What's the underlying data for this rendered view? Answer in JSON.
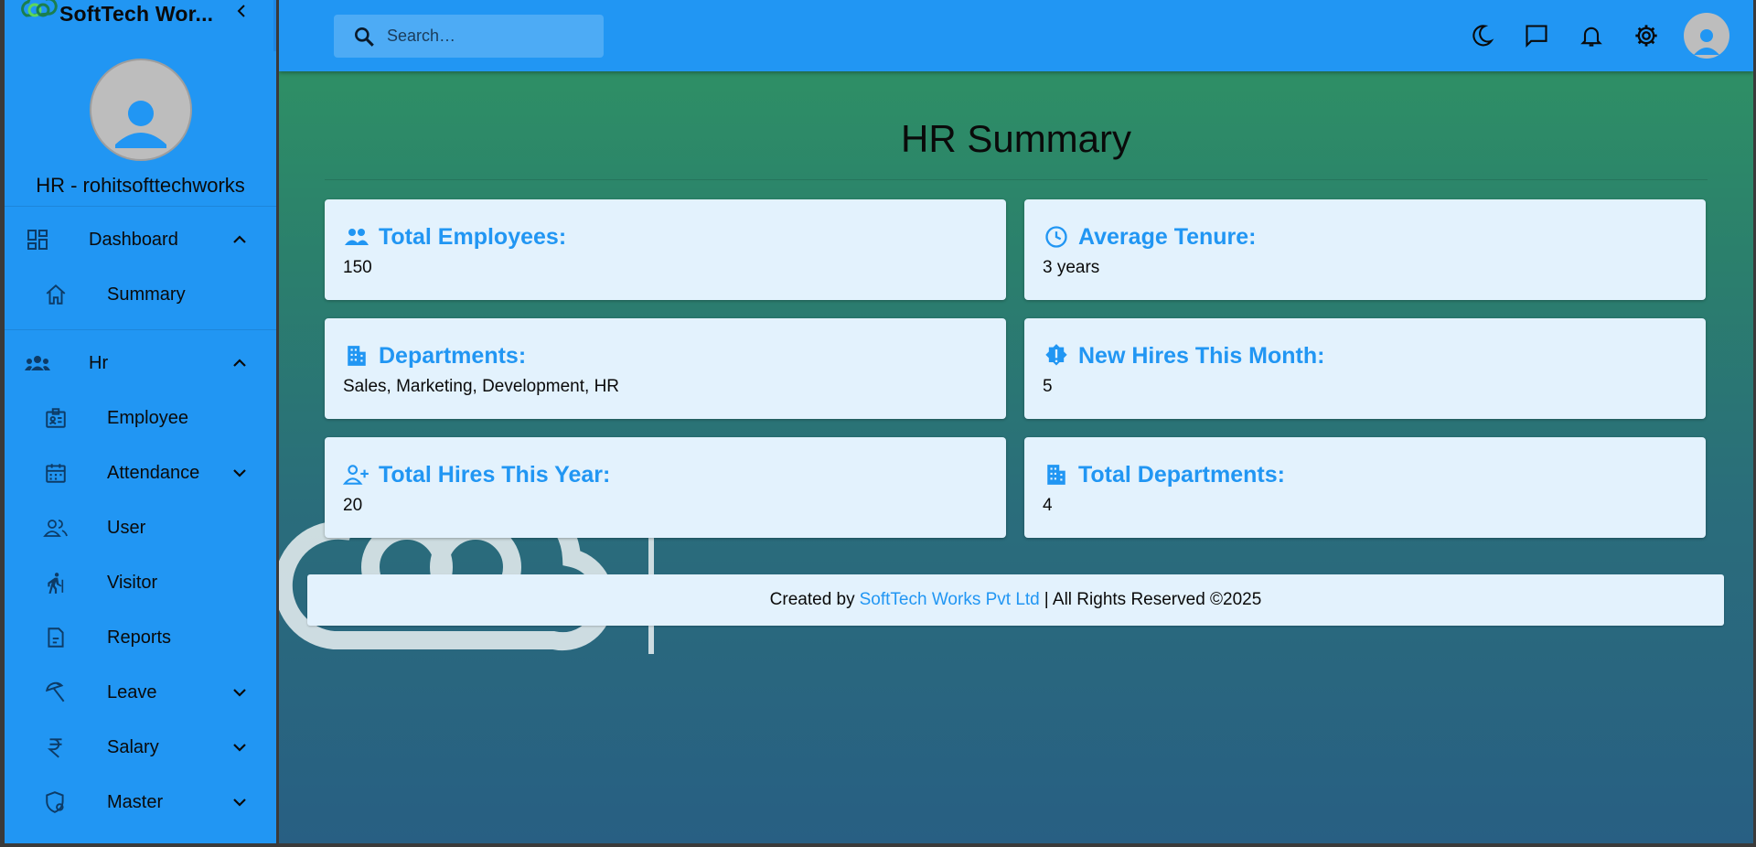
{
  "app": {
    "title": "SoftTech Wor..."
  },
  "sidebar": {
    "profile_name": "HR - rohitsofttechworks",
    "sections": [
      {
        "label": "Dashboard",
        "icon": "dashboard-icon",
        "expanded": true,
        "items": [
          {
            "label": "Summary",
            "icon": "home-icon"
          }
        ]
      },
      {
        "label": "Hr",
        "icon": "groups-icon",
        "expanded": true,
        "items": [
          {
            "label": "Employee",
            "icon": "badge-icon"
          },
          {
            "label": "Attendance",
            "icon": "calendar-icon",
            "has_children": true
          },
          {
            "label": "User",
            "icon": "people-icon"
          },
          {
            "label": "Visitor",
            "icon": "person-walking-icon"
          },
          {
            "label": "Reports",
            "icon": "report-icon"
          },
          {
            "label": "Leave",
            "icon": "beach-umbrella-icon",
            "has_children": true
          },
          {
            "label": "Salary",
            "icon": "rupee-icon",
            "has_children": true
          },
          {
            "label": "Master",
            "icon": "shield-gear-icon",
            "has_children": true
          }
        ]
      }
    ]
  },
  "topbar": {
    "search_placeholder": "Search…",
    "icons": [
      "dark-mode-icon",
      "chat-icon",
      "notification-bell-icon",
      "settings-gear-icon",
      "account-avatar-icon"
    ]
  },
  "main": {
    "title": "HR Summary",
    "cards": [
      {
        "title": "Total Employees:",
        "value": "150",
        "icon": "people-icon"
      },
      {
        "title": "Average Tenure:",
        "value": "3 years",
        "icon": "clock-icon"
      },
      {
        "title": "Departments:",
        "value": "Sales, Marketing, Development, HR",
        "icon": "building-icon"
      },
      {
        "title": "New Hires This Month:",
        "value": "5",
        "icon": "new-badge-icon"
      },
      {
        "title": "Total Hires This Year:",
        "value": "20",
        "icon": "person-add-icon"
      },
      {
        "title": "Total Departments:",
        "value": "4",
        "icon": "building-icon"
      }
    ]
  },
  "footer": {
    "prefix": "Created by",
    "link": "SoftTech Works Pvt Ltd",
    "suffix": "| All Rights Reserved ©2025"
  },
  "colors": {
    "primary": "#2196F3",
    "card_bg": "#e3f2fd",
    "gradient_top": "#2f9563",
    "gradient_bottom": "#285f83"
  }
}
